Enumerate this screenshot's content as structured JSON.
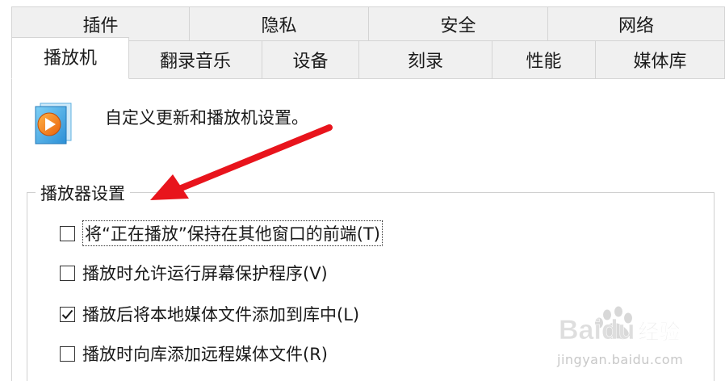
{
  "tabs": {
    "top_row": [
      {
        "label": "插件"
      },
      {
        "label": "隐私"
      },
      {
        "label": "安全"
      },
      {
        "label": "网络"
      }
    ],
    "bottom_row": [
      {
        "label": "播放机",
        "selected": true
      },
      {
        "label": "翻录音乐"
      },
      {
        "label": "设备"
      },
      {
        "label": "刻录"
      },
      {
        "label": "性能"
      },
      {
        "label": "媒体库"
      }
    ]
  },
  "header": {
    "icon": "media-player-icon",
    "text": "自定义更新和播放机设置。"
  },
  "player_settings": {
    "legend": "播放器设置",
    "options": [
      {
        "label": "将“正在播放”保持在其他窗口的前端(T)",
        "checked": false,
        "focused": true
      },
      {
        "label": "播放时允许运行屏幕保护程序(V)",
        "checked": false
      },
      {
        "label": "播放后将本地媒体文件添加到库中(L)",
        "checked": true
      },
      {
        "label": "播放时向库添加远程媒体文件(R)",
        "checked": false
      }
    ]
  },
  "annotation": {
    "color": "#e8141c"
  },
  "watermark": {
    "logo": "Baidu",
    "logo_suffix": "经验",
    "url": "jingyan.baidu.com"
  }
}
